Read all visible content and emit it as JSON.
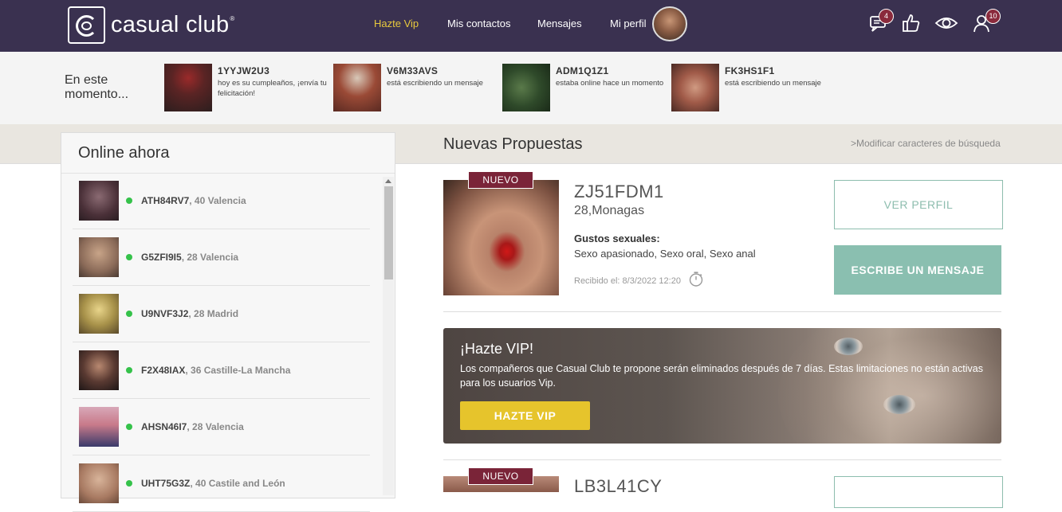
{
  "brand": {
    "name": "casual club",
    "reg_mark": "®"
  },
  "nav": [
    {
      "label": "Hazte Vip"
    },
    {
      "label": "Mis contactos"
    },
    {
      "label": "Mensajes"
    },
    {
      "label": "Mi perfil"
    }
  ],
  "header_icons": [
    {
      "icon": "chat-icon",
      "badge": "4"
    },
    {
      "icon": "thumbs-up-icon",
      "badge": ""
    },
    {
      "icon": "eye-icon",
      "badge": ""
    },
    {
      "icon": "users-icon",
      "badge": "10"
    }
  ],
  "activity": {
    "title": "En este momento...",
    "items": [
      {
        "name": "1YYJW2U3",
        "status": "hoy es su cumpleaños, ¡envía tu felicitación!"
      },
      {
        "name": "V6M33AVS",
        "status": "está escribiendo un mensaje"
      },
      {
        "name": "ADM1Q1Z1",
        "status": "estaba online hace un momento"
      },
      {
        "name": "FK3HS1F1",
        "status": "está escribiendo un mensaje"
      }
    ]
  },
  "online": {
    "title": "Online ahora",
    "users": [
      {
        "name": "ATH84RV7",
        "details": ", 40  Valencia"
      },
      {
        "name": "G5ZFI9I5",
        "details": ", 28  Valencia"
      },
      {
        "name": "U9NVF3J2",
        "details": ", 28  Madrid"
      },
      {
        "name": "F2X48IAX",
        "details": ", 36  Castille-La Mancha"
      },
      {
        "name": "AHSN46I7",
        "details": ", 28  Valencia"
      },
      {
        "name": "UHT75G3Z",
        "details": ", 40  Castile and León"
      }
    ]
  },
  "proposals": {
    "title": "Nuevas Propuestas",
    "modify_link": ">Modificar caracteres de búsqueda",
    "card1": {
      "tag": "NUEVO",
      "name": "ZJ51FDM1",
      "age_location": "28,Monagas",
      "tastes_label": "Gustos sexuales:",
      "tastes": "Sexo apasionado, Sexo oral, Sexo anal",
      "received": "Recibido el:  8/3/2022 12:20",
      "view_button": "VER PERFIL",
      "message_button": "ESCRIBE UN MENSAJE"
    },
    "card2": {
      "tag": "NUEVO",
      "name": "LB3L41CY"
    }
  },
  "vip_banner": {
    "title": "¡Hazte VIP!",
    "text": "Los compañeros que Casual Club te propone serán eliminados después de 7 días. Estas limitaciones no están activas para los usuarios Vip.",
    "button": "HAZTE VIP"
  },
  "colors": {
    "header": "#3a3150",
    "vip": "#e8c93d",
    "accent_teal": "#8abfb0",
    "tag": "#7a2438",
    "online": "#35c24a"
  }
}
